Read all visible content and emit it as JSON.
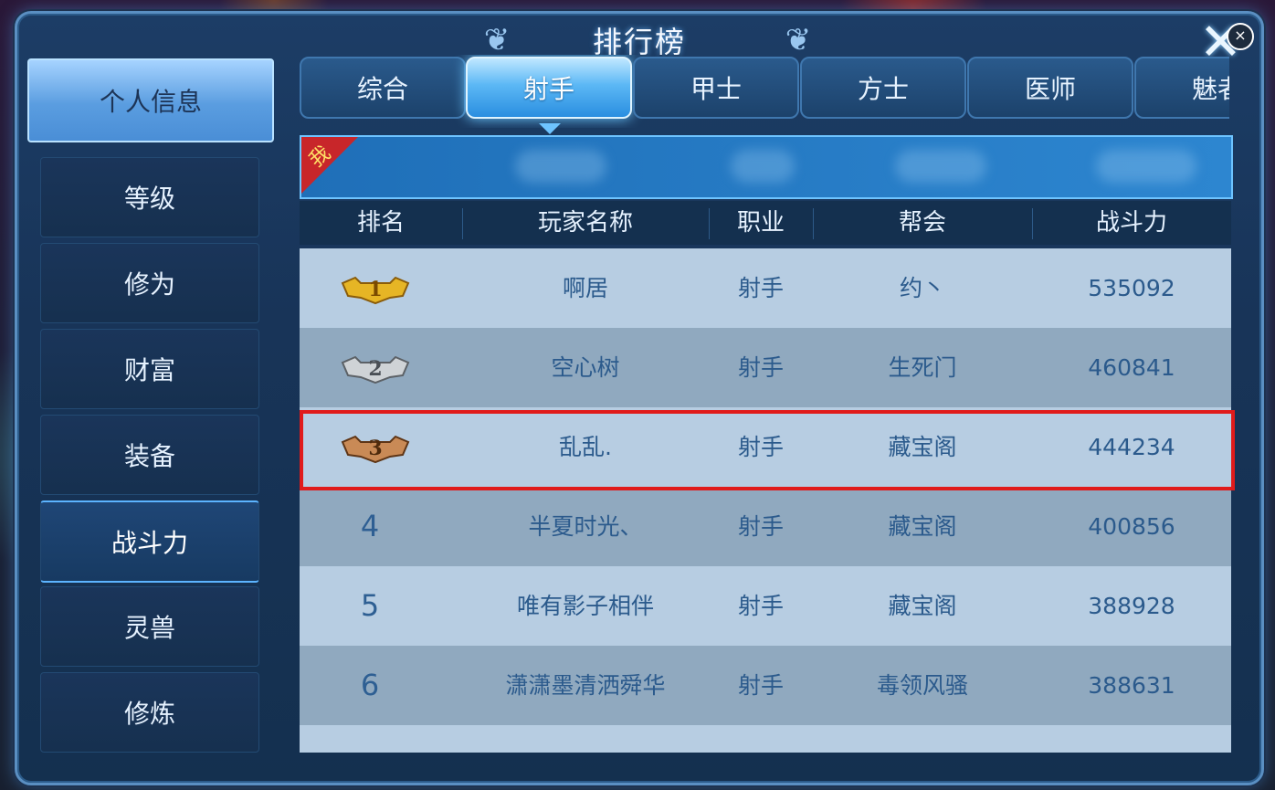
{
  "window": {
    "title": "排行榜",
    "close_icon": "close-x-icon"
  },
  "sidebar": {
    "items": [
      {
        "label": "个人信息",
        "state": "selected"
      },
      {
        "label": "等级"
      },
      {
        "label": "修为"
      },
      {
        "label": "财富"
      },
      {
        "label": "装备"
      },
      {
        "label": "战斗力",
        "state": "active"
      },
      {
        "label": "灵兽"
      },
      {
        "label": "修炼"
      }
    ]
  },
  "tabs": [
    {
      "label": "综合"
    },
    {
      "label": "射手",
      "active": true
    },
    {
      "label": "甲士"
    },
    {
      "label": "方士"
    },
    {
      "label": "医师"
    },
    {
      "label": "魅者"
    }
  ],
  "my_row": {
    "badge": "我"
  },
  "table": {
    "headers": [
      "排名",
      "玩家名称",
      "职业",
      "帮会",
      "战斗力"
    ],
    "rows": [
      {
        "rank": "1",
        "medal": "gold-medal-icon",
        "name": "啊居",
        "class": "射手",
        "guild": "约丶",
        "power": "535092"
      },
      {
        "rank": "2",
        "medal": "silver-medal-icon",
        "name": "空心树",
        "class": "射手",
        "guild": "生死门",
        "power": "460841"
      },
      {
        "rank": "3",
        "medal": "bronze-medal-icon",
        "name": "乱乱.",
        "class": "射手",
        "guild": "藏宝阁",
        "power": "444234",
        "highlighted": true
      },
      {
        "rank": "4",
        "name": "半夏时光、",
        "class": "射手",
        "guild": "藏宝阁",
        "power": "400856"
      },
      {
        "rank": "5",
        "name": "唯有影子相伴",
        "class": "射手",
        "guild": "藏宝阁",
        "power": "388928"
      },
      {
        "rank": "6",
        "name": "潇潇墨清洒舜华",
        "class": "射手",
        "guild": "毒领风骚",
        "power": "388631"
      }
    ]
  },
  "colors": {
    "highlight": "#e01b1b",
    "accent": "#5cb8f5"
  }
}
